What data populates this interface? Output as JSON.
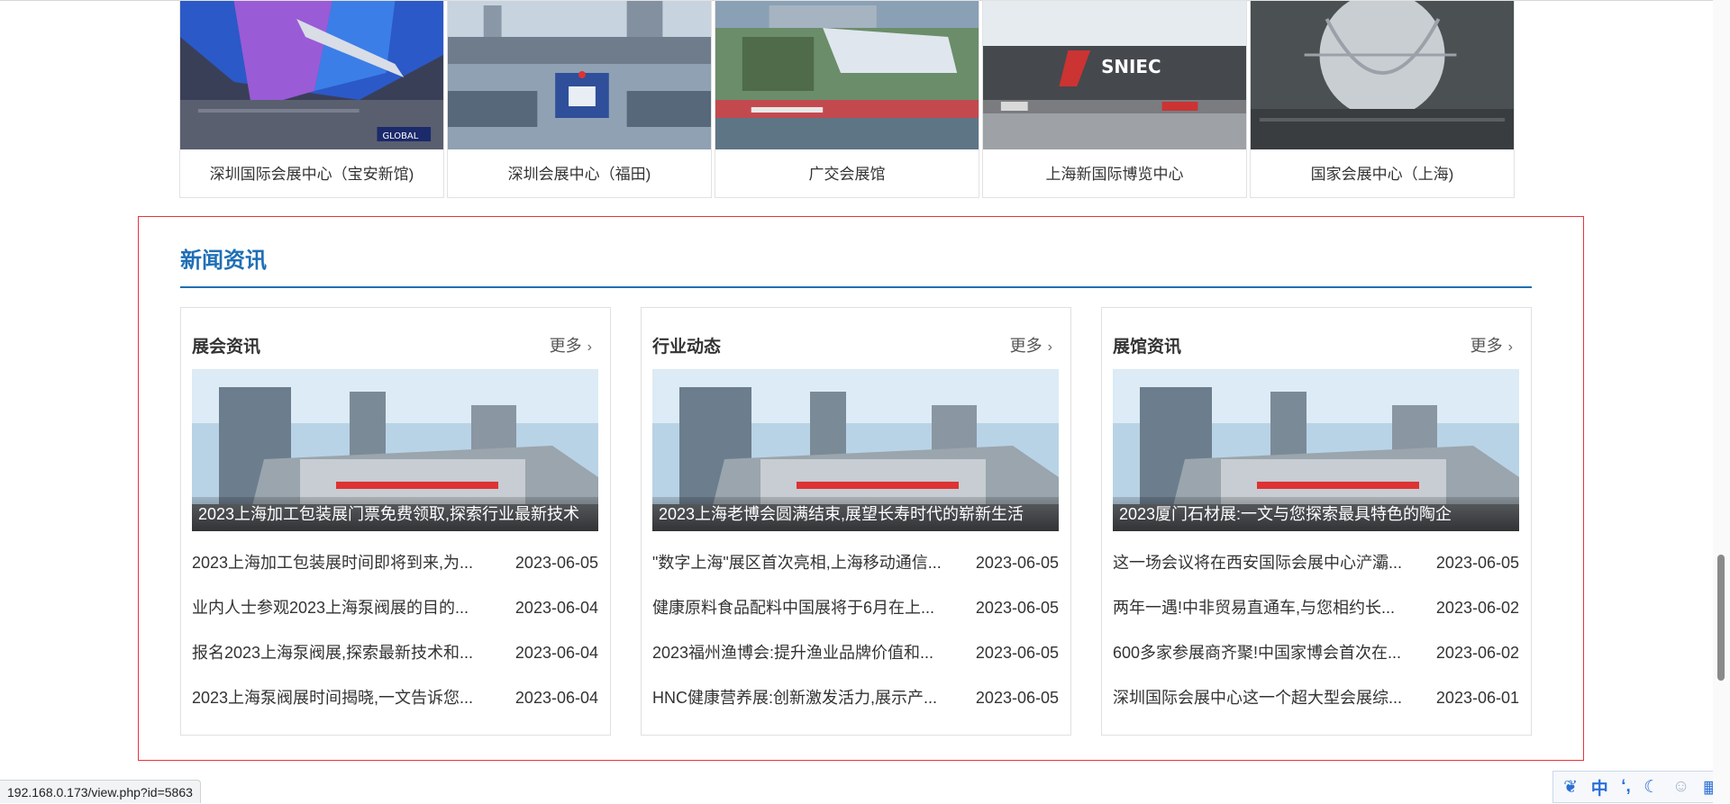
{
  "venues": [
    {
      "name": "深圳国际会展中心（宝安新馆)"
    },
    {
      "name": "深圳会展中心（福田)"
    },
    {
      "name": "广交会展馆"
    },
    {
      "name": "上海新国际博览中心"
    },
    {
      "name": "国家会展中心（上海)"
    }
  ],
  "news": {
    "title": "新闻资讯",
    "more_label": "更多",
    "columns": [
      {
        "title": "展会资讯",
        "featured": "2023上海加工包装展门票免费领取,探索行业最新技术",
        "items": [
          {
            "title": "2023上海加工包装展时间即将到来,为...",
            "date": "2023-06-05"
          },
          {
            "title": "业内人士参观2023上海泵阀展的目的...",
            "date": "2023-06-04"
          },
          {
            "title": "报名2023上海泵阀展,探索最新技术和...",
            "date": "2023-06-04"
          },
          {
            "title": "2023上海泵阀展时间揭晓,一文告诉您...",
            "date": "2023-06-04"
          }
        ]
      },
      {
        "title": "行业动态",
        "featured": "2023上海老博会圆满结束,展望长寿时代的崭新生活",
        "items": [
          {
            "title": "\"数字上海\"展区首次亮相,上海移动通信...",
            "date": "2023-06-05"
          },
          {
            "title": "健康原料食品配料中国展将于6月在上...",
            "date": "2023-06-05"
          },
          {
            "title": "2023福州渔博会:提升渔业品牌价值和...",
            "date": "2023-06-05"
          },
          {
            "title": "HNC健康营养展:创新激发活力,展示产...",
            "date": "2023-06-05"
          }
        ]
      },
      {
        "title": "展馆资讯",
        "featured": "2023厦门石材展:一文与您探索最具特色的陶企",
        "items": [
          {
            "title": "这一场会议将在西安国际会展中心浐灞...",
            "date": "2023-06-05"
          },
          {
            "title": "两年一遇!中非贸易直通车,与您相约长...",
            "date": "2023-06-02"
          },
          {
            "title": "600多家参展商齐聚!中国家博会首次在...",
            "date": "2023-06-02"
          },
          {
            "title": "深圳国际会展中心这一个超大型会展综...",
            "date": "2023-06-01"
          }
        ]
      }
    ]
  },
  "status_bar": {
    "url": "192.168.0.173/view.php?id=5863"
  },
  "ime_toolbar": {
    "icons": [
      "paw-icon",
      "chinese-mode-icon",
      "punctuation-icon",
      "moon-icon",
      "user-icon",
      "grid-icon"
    ],
    "mode_label": "中"
  },
  "colors": {
    "accent": "#1f6fb5",
    "frame": "#e8343f"
  }
}
